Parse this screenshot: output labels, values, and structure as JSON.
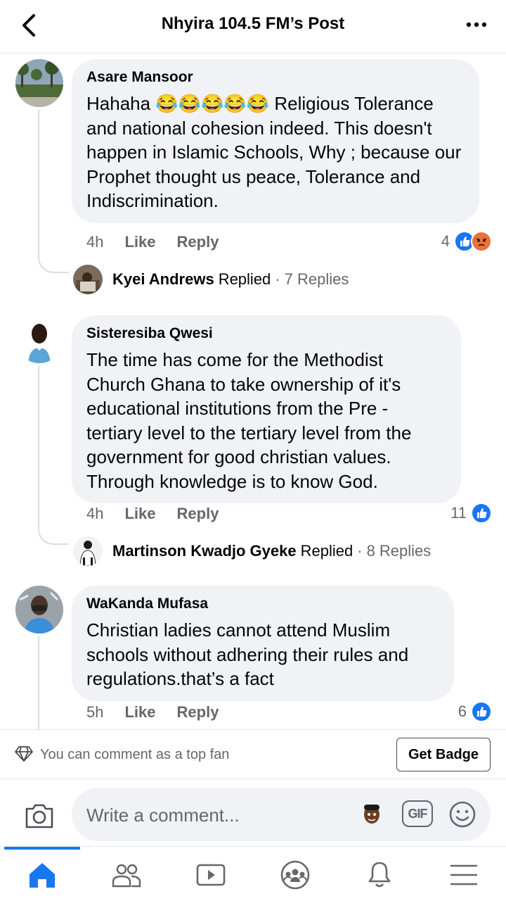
{
  "header": {
    "title": "Nhyira 104.5 FM’s Post"
  },
  "comments": [
    {
      "author": "Asare Mansoor",
      "text": "Hahaha 😂😂😂😂😂 Religious Tolerance and national cohesion indeed. This doesn't happen in Islamic Schools, Why ; because our Prophet thought us peace, Tolerance and Indiscrimination.",
      "time": "4h",
      "like": "Like",
      "reply": "Reply",
      "reaction_count": "4",
      "reply_summary": {
        "name": "Kyei Andrews",
        "verb": "Replied",
        "count": "7 Replies"
      }
    },
    {
      "author": "Sisteresiba Qwesi",
      "text": "The time has come for the Methodist Church Ghana to take ownership of it's educational institutions from the Pre - tertiary level to the tertiary level from the government for good christian values. Through knowledge is to know God.",
      "time": "4h",
      "like": "Like",
      "reply": "Reply",
      "reaction_count": "11",
      "reply_summary": {
        "name": "Martinson Kwadjo Gyeke",
        "verb": "Replied",
        "count": "8 Replies"
      }
    },
    {
      "author": "WaKanda Mufasa",
      "text": "Christian ladies cannot attend Muslim schools without adhering their rules and regulations.that’s a fact",
      "time": "5h",
      "like": "Like",
      "reply": "Reply",
      "reaction_count": "6"
    }
  ],
  "fanbar": {
    "text": "You can comment as a top fan",
    "button": "Get Badge"
  },
  "composer": {
    "placeholder": "Write a comment...",
    "gif": "GIF"
  },
  "colors": {
    "accent": "#1877f2",
    "bubble": "#f0f2f5",
    "muted": "#65676b"
  },
  "nav": [
    "home-icon",
    "friends-icon",
    "watch-icon",
    "groups-icon",
    "notifications-icon",
    "menu-icon"
  ]
}
